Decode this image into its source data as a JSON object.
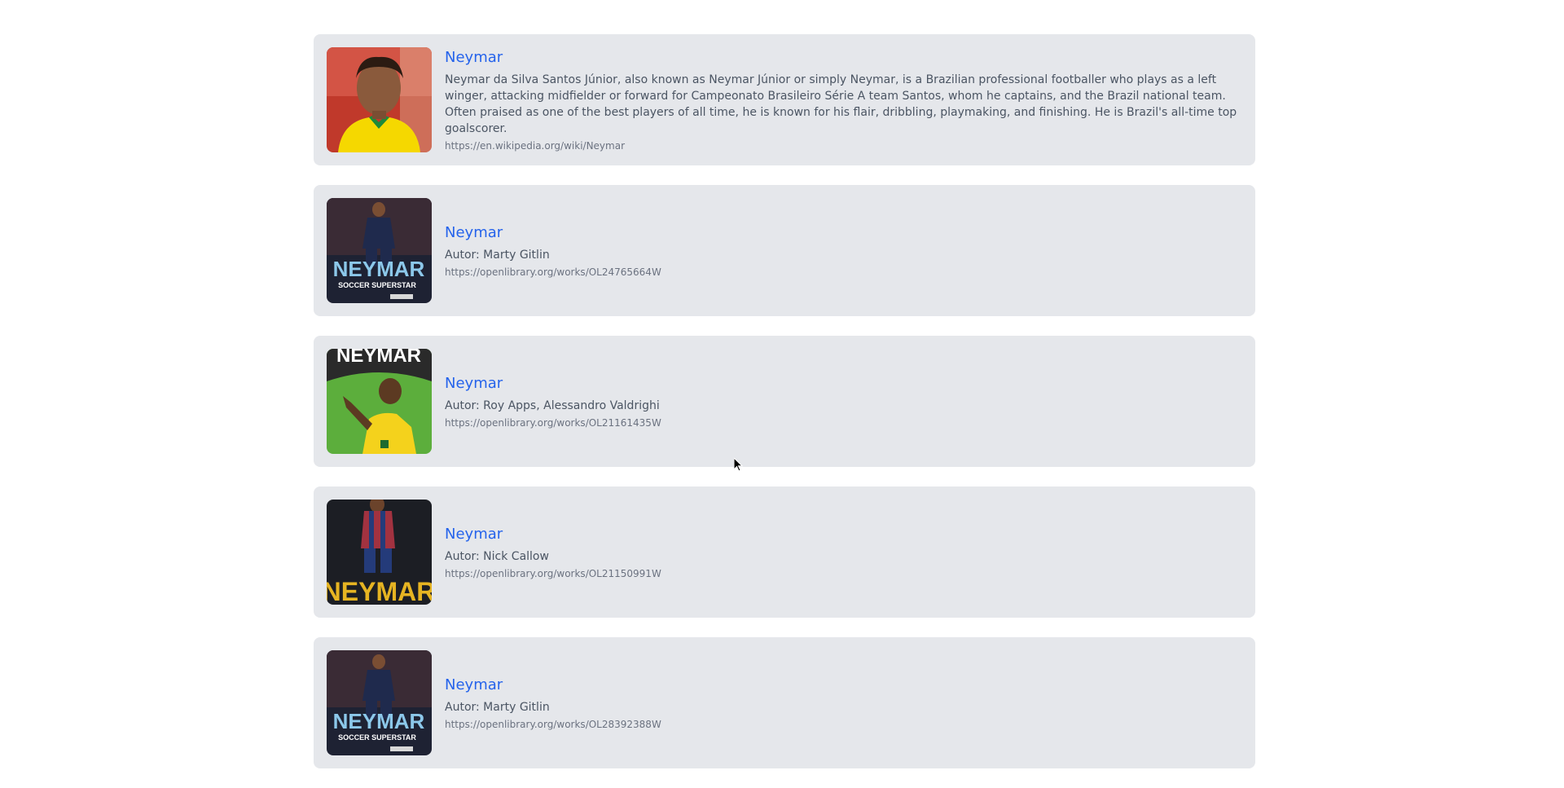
{
  "results": [
    {
      "title": "Neymar",
      "description": "Neymar da Silva Santos Júnior, also known as Neymar Júnior or simply Neymar, is a Brazilian professional footballer who plays as a left winger, attacking midfielder or forward for Campeonato Brasileiro Série A team Santos, whom he captains, and the Brazil national team. Often praised as one of the best players of all time, he is known for his flair, dribbling, playmaking, and finishing. He is Brazil's all-time top goalscorer.",
      "url": "https://en.wikipedia.org/wiki/Neymar",
      "thumb_caption": ""
    },
    {
      "title": "Neymar",
      "description": "Autor: Marty Gitlin",
      "url": "https://openlibrary.org/works/OL24765664W",
      "thumb_caption": "NEYMAR",
      "thumb_subcaption": "SOCCER SUPERSTAR"
    },
    {
      "title": "Neymar",
      "description": "Autor: Roy Apps, Alessandro Valdrighi",
      "url": "https://openlibrary.org/works/OL21161435W",
      "thumb_caption": "NEYMAR"
    },
    {
      "title": "Neymar",
      "description": "Autor: Nick Callow",
      "url": "https://openlibrary.org/works/OL21150991W",
      "thumb_caption": "NEYMAR"
    },
    {
      "title": "Neymar",
      "description": "Autor: Marty Gitlin",
      "url": "https://openlibrary.org/works/OL28392388W",
      "thumb_caption": "NEYMAR",
      "thumb_subcaption": "SOCCER SUPERSTAR"
    }
  ],
  "colors": {
    "card_bg": "#e5e7eb",
    "title": "#2563eb",
    "text": "#4b5563",
    "url": "#6b7280"
  }
}
